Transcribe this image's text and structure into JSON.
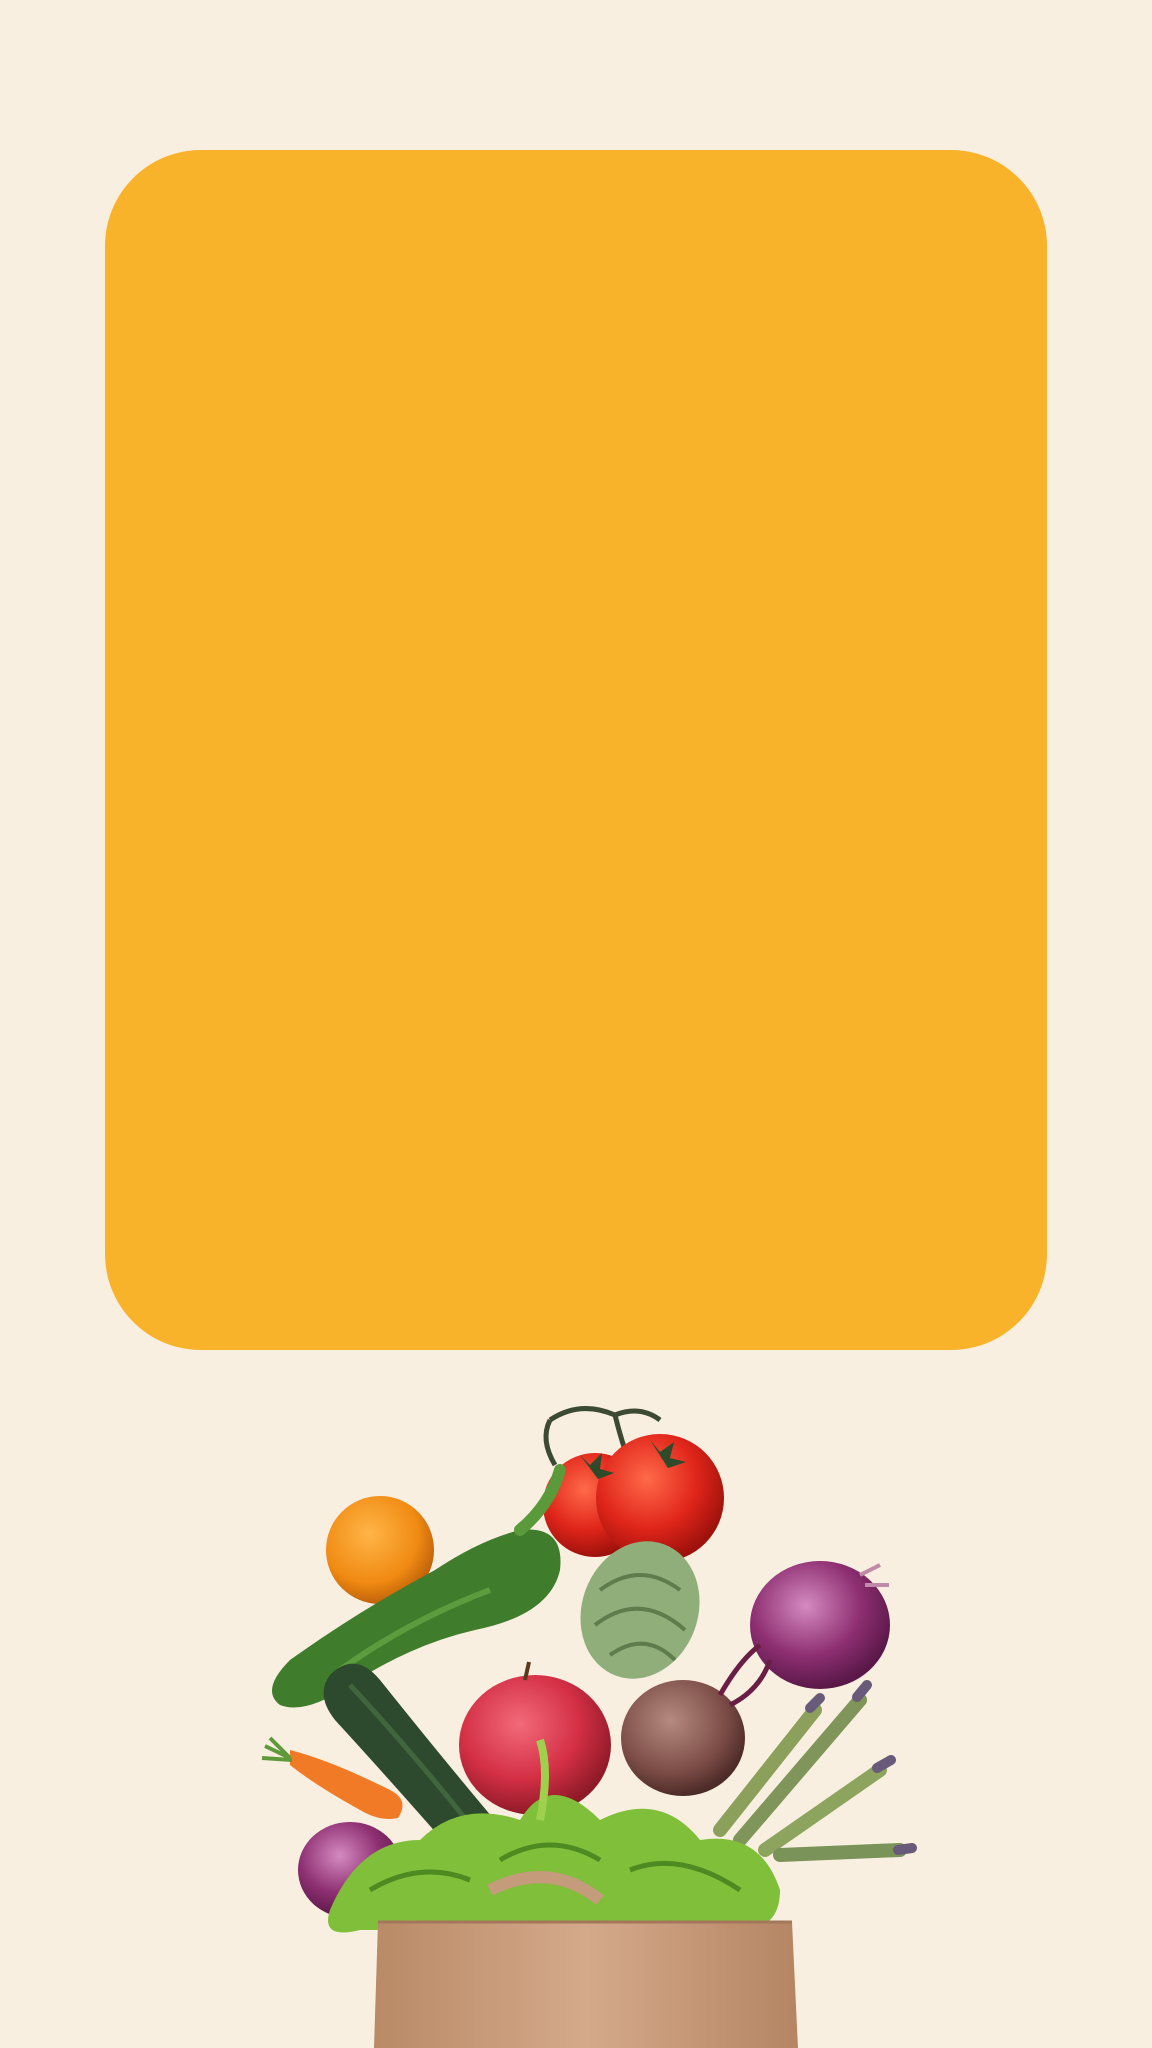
{
  "background_color": "#f8efe1",
  "card": {
    "color": "#f9b32b"
  },
  "illustration": {
    "icon": "groceries-bag-icon",
    "items": [
      "tomato",
      "tomato",
      "orange",
      "green-pepper",
      "artichoke",
      "red-onion",
      "cucumber",
      "apple",
      "beetroot",
      "carrot",
      "asparagus",
      "lettuce",
      "red-onion",
      "paper-bag"
    ]
  }
}
